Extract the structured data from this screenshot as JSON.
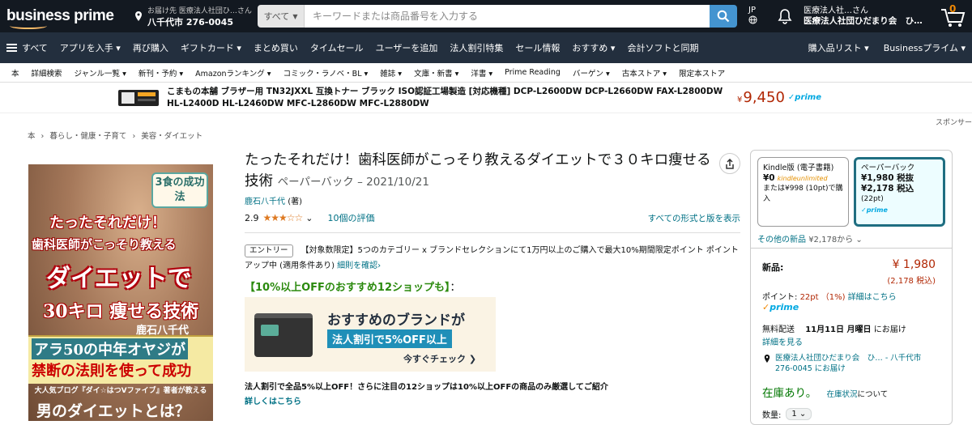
{
  "header": {
    "logo": "business prime",
    "deliver_line1": "お届け先 医療法人社団ひ…さん",
    "deliver_line2": "八千代市 276-0045",
    "search_category": "すべて",
    "search_placeholder": "キーワードまたは商品番号を入力する",
    "lang": "JP",
    "account_line1": "医療法人社…さん",
    "account_line2": "医療法人社団ひだまり会　ひ…",
    "cart_count": "0"
  },
  "nav": {
    "all": "すべて",
    "items": [
      "アプリを入手 ▾",
      "再び購入",
      "ギフトカード ▾",
      "まとめ買い",
      "タイムセール",
      "ユーザーを追加",
      "法人割引特集",
      "セール情報",
      "おすすめ ▾",
      "会計ソフトと同期"
    ],
    "right_items": [
      "購入品リスト ▾",
      "Businessプライム ▾"
    ]
  },
  "subnav": {
    "items": [
      "本",
      "詳細検索",
      "ジャンル一覧 ▾",
      "新刊・予約 ▾",
      "Amazonランキング ▾",
      "コミック・ラノベ・BL ▾",
      "雑誌 ▾",
      "文庫・新書 ▾",
      "洋書 ▾",
      "Prime Reading",
      "バーゲン ▾",
      "古本ストア ▾",
      "限定本ストア"
    ]
  },
  "ad": {
    "text": "こまもの本舗 ブラザー用 TN32JXXL 互換トナー ブラック ISO認証工場製造 [対応機種] DCP-L2600DW DCP-L2660DW FAX-L2800DW HL-L2400D HL-L2460DW MFC-L2860DW MFC-L2880DW",
    "price_symbol": "¥",
    "price": "9,450",
    "prime": "✓prime",
    "sponsor": "スポンサー"
  },
  "breadcrumb": [
    "本",
    "›",
    "暮らし・健康・子育て",
    "›",
    "美容・ダイエット"
  ],
  "cover": {
    "badge": "3食の成功法",
    "line1": "たったそれだけ！",
    "line2": "歯科医師がこっそり教える",
    "line3": "ダイエットで",
    "line4": "30キロ 痩せる技術",
    "author": "鹿石八千代",
    "line5": "アラ50の中年オヤジが",
    "line6": "禁断の法則を使って成功",
    "line7": "大人気ブログ『ダイ☆はつVファイブ』著者が教える",
    "line8": "男のダイエットとは？"
  },
  "product": {
    "title": "たったそれだけ！歯科医師がこっそり教えるダイエットで３０キロ痩せる技術",
    "format": "ペーパーバック – 2021/10/21",
    "author": "鹿石八千代",
    "author_role": "(著)",
    "rating": "2.9",
    "stars": "★★★☆☆",
    "rating_caret": "⌄",
    "rating_count": "10個の評価",
    "all_formats": "すべての形式と版を表示",
    "promo_tag": "エントリー",
    "promo_text": "【対象数限定】5つのカテゴリー x ブランドセレクションにて1万円以上のご購入で最大10%期間限定ポイント ポイントアップ中 (適用条件あり)",
    "promo_link": "細則を確認›",
    "green_head": "【10%以上OFFのおすすめ12ショップも】",
    "green_tail": "：",
    "banner_h1": "おすすめのブランドが",
    "banner_h2": "法人割引で5%OFF以上",
    "banner_h3": "今すぐチェック ❯",
    "discount_text": "法人割引で全品5%以上OFF！さらに注目の12ショップは10%以上OFFの商品のみ厳選してご紹介",
    "details_link": "詳しくはこちら"
  },
  "buybox": {
    "kindle_name": "Kindle版 (電子書籍)",
    "kindle_price": "¥0",
    "kindle_ku": "kindleunlimited",
    "kindle_sub": "または¥998 (10pt)で購入",
    "paper_name": "ペーパーバック",
    "paper_price1": "¥1,980 税抜",
    "paper_price2": "¥2,178 税込",
    "paper_pt": "(22pt)",
    "paper_prime": "✓prime",
    "other_new": "その他の新品",
    "other_new_price": "¥2,178から ⌄",
    "new_label": "新品:",
    "new_price": "¥ 1,980",
    "new_tax": "(2,178 税込)",
    "points_label": "ポイント:",
    "points_value": "22pt （1%)",
    "points_link": "詳細はこちら",
    "prime": "prime",
    "prime_check": "✓",
    "delivery_label": "無料配送",
    "delivery_date": "11月11日 月曜日",
    "delivery_tail": "にお届け",
    "delivery_link": "詳細を見る",
    "address": "医療法人社団ひだまり会　ひ… - 八千代市 276-0045 にお届け",
    "stock": "在庫あり。",
    "stock_status": "在庫状況",
    "stock_status_tail": "について",
    "qty_label": "数量:",
    "qty_value": "1 ⌄"
  },
  "colors": {
    "header_bg": "#131921",
    "nav_bg": "#232f3e",
    "link": "#007185",
    "price": "#b12704",
    "in_stock": "#007600",
    "prime": "#00a8e1",
    "selected_format_border": "#1f6e81"
  }
}
